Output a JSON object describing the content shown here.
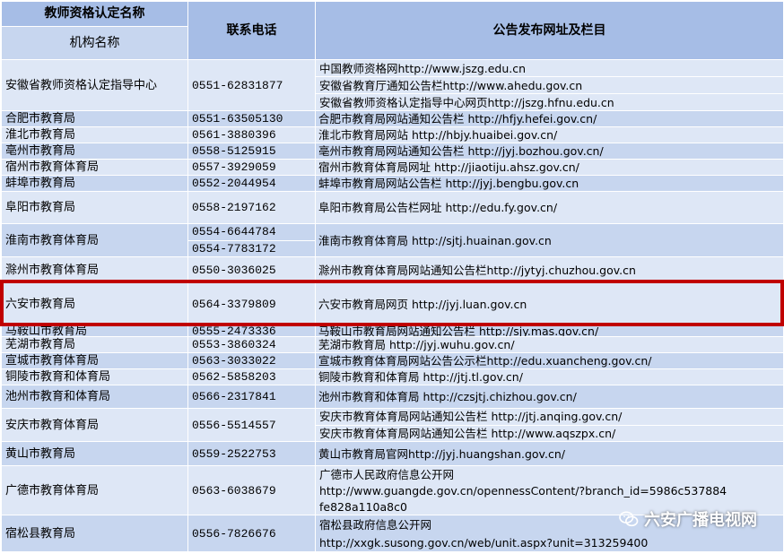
{
  "header": {
    "col1_title": "教师资格认定名称",
    "col1_sub": "机构名称",
    "col2": "联系电话",
    "col3": "公告发布网址及栏目"
  },
  "rows": [
    {
      "org": "安徽省教师资格认定指导中心",
      "phones": [
        "0551-62831877"
      ],
      "sites": [
        "中国教师资格网http://www.jszg.edu.cn",
        "安徽省教育厅通知公告栏http://www.ahedu.gov.cn",
        "安徽省教师资格认定指导中心网页http://jszg.hfnu.edu.cn"
      ]
    },
    {
      "org": "合肥市教育局",
      "phones": [
        "0551-63505130"
      ],
      "sites": [
        "合肥市教育局网站通知公告栏 http://hfjy.hefei.gov.cn/"
      ]
    },
    {
      "org": "淮北市教育局",
      "phones": [
        "0561-3880396"
      ],
      "sites": [
        "淮北市教育局网站 http://hbjy.huaibei.gov.cn/"
      ]
    },
    {
      "org": "亳州市教育局",
      "phones": [
        "0558-5125915"
      ],
      "sites": [
        "亳州市教育局网站通知公告栏 http://jyj.bozhou.gov.cn/"
      ]
    },
    {
      "org": "宿州市教育体育局",
      "phones": [
        "0557-3929059"
      ],
      "sites": [
        "宿州市教育体育局网址 http://jiaotiju.ahsz.gov.cn/"
      ]
    },
    {
      "org": "蚌埠市教育局",
      "phones": [
        "0552-2044954"
      ],
      "sites": [
        "蚌埠市教育局网站公告栏 http://jyj.bengbu.gov.cn"
      ]
    },
    {
      "org": "阜阳市教育局",
      "phones": [
        "0558-2197162"
      ],
      "sites": [
        "阜阳市教育局公告栏网址 http://edu.fy.gov.cn/"
      ]
    },
    {
      "org": "淮南市教育体育局",
      "phones": [
        "0554-6644784",
        "0554-7783172"
      ],
      "sites": [
        "淮南市教育体育局 http://sjtj.huainan.gov.cn"
      ]
    },
    {
      "org": "滁州市教育体育局",
      "phones": [
        "0550-3036025"
      ],
      "sites": [
        "滁州市教育体育局网站通知公告栏http://jytyj.chuzhou.gov.cn"
      ]
    },
    {
      "org": "六安市教育局",
      "phones": [
        "0564-3379809"
      ],
      "sites": [
        "六安市教育局网页 http://jyj.luan.gov.cn"
      ]
    },
    {
      "org": "马鞍山市教育局",
      "phones": [
        "0555-2473336"
      ],
      "sites": [
        "马鞍山市教育局网站通知公告栏 http://sjy.mas.gov.cn/"
      ]
    },
    {
      "org": "芜湖市教育局",
      "phones": [
        "0553-3860324"
      ],
      "sites": [
        "芜湖市教育局 http://jyj.wuhu.gov.cn/"
      ]
    },
    {
      "org": "宣城市教育体育局",
      "phones": [
        "0563-3033022"
      ],
      "sites": [
        "宣城市教育体育局网站公告公示栏http://edu.xuancheng.gov.cn/"
      ]
    },
    {
      "org": "铜陵市教育和体育局",
      "phones": [
        "0562-5858203"
      ],
      "sites": [
        "铜陵市教育和体育局 http://jtj.tl.gov.cn/"
      ]
    },
    {
      "org": "池州市教育和体育局",
      "phones": [
        "0566-2317841"
      ],
      "sites": [
        "池州市教育和体育局 http://czsjtj.chizhou.gov.cn/"
      ]
    },
    {
      "org": "安庆市教育体育局",
      "phones": [
        "0556-5514557"
      ],
      "sites": [
        "安庆市教育体育局网站通知公告栏 http://jtj.anqing.gov.cn/",
        "安庆市教育体育局网站通知公告栏 http://www.aqszpx.cn/"
      ]
    },
    {
      "org": "黄山市教育局",
      "phones": [
        "0559-2522753"
      ],
      "sites": [
        "黄山市教育局官网http://jyj.huangshan.gov.cn/"
      ]
    },
    {
      "org": "广德市教育体育局",
      "phones": [
        "0563-6038679"
      ],
      "sites": [
        "广德市人民政府信息公开网",
        "http://www.guangde.gov.cn/opennessContent/?branch_id=5986c537884",
        "fe828a110a8c0"
      ]
    },
    {
      "org": "宿松县教育局",
      "phones": [
        "0556-7826676"
      ],
      "sites": [
        "宿松县政府信息公开网",
        "http://xxgk.susong.gov.cn/web/unit.aspx?unit=313259400"
      ]
    }
  ],
  "watermark": {
    "text": "六安广播电视网",
    "icon": "wechat-icon"
  },
  "colors": {
    "header": "#a6bde6",
    "row_a": "#c7d6ef",
    "row_b": "#dee7f6",
    "highlight": "#c00000"
  }
}
